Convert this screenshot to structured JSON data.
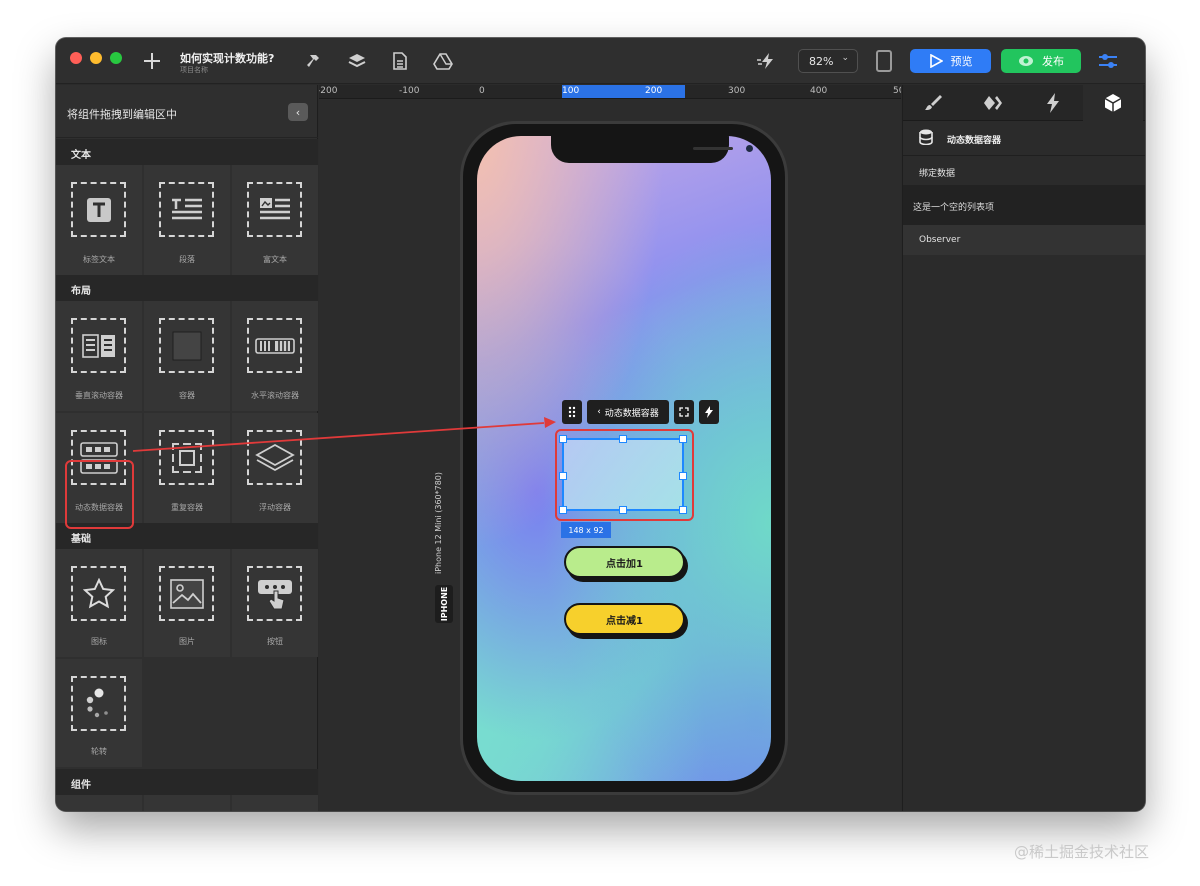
{
  "titlebar": {
    "project_title": "如何实现计数功能?",
    "project_subtitle": "项目名称",
    "zoom": "82%",
    "preview_label": "预览",
    "publish_label": "发布"
  },
  "left_panel": {
    "header": "将组件拖拽到编辑区中",
    "sections": {
      "text": "文本",
      "layout": "布局",
      "basic": "基础",
      "components": "组件"
    },
    "items": {
      "label_text": "标签文本",
      "paragraph": "段落",
      "rich_text": "富文本",
      "vertical_scroll": "垂直滚动容器",
      "container": "容器",
      "horizontal_scroll": "水平滚动容器",
      "dynamic_data": "动态数据容器",
      "repeat": "重复容器",
      "float": "浮动容器",
      "icon": "图标",
      "image": "图片",
      "button": "按钮",
      "carousel": "轮转"
    }
  },
  "canvas": {
    "ruler_labels": [
      "-200",
      "-100",
      "0",
      "100",
      "200",
      "300",
      "400",
      "50"
    ],
    "device_label": "iPhone 12 Mini (360*780)",
    "device_tag": "IPHONE",
    "selection_toolbar_label": "动态数据容器",
    "size_badge": "148 x 92",
    "button_add": "点击加1",
    "button_sub": "点击减1"
  },
  "right_panel": {
    "title": "动态数据容器",
    "bind_data": "绑定数据",
    "empty_item": "这是一个空的列表项",
    "observer": "Observer"
  },
  "watermark": "@稀土掘金技术社区",
  "colors": {
    "accent_blue": "#2f7cf6",
    "publish_green": "#22c55e",
    "highlight_red": "#e03a3a",
    "btn_green": "#b9ec8c",
    "btn_yellow": "#f7d02c"
  }
}
